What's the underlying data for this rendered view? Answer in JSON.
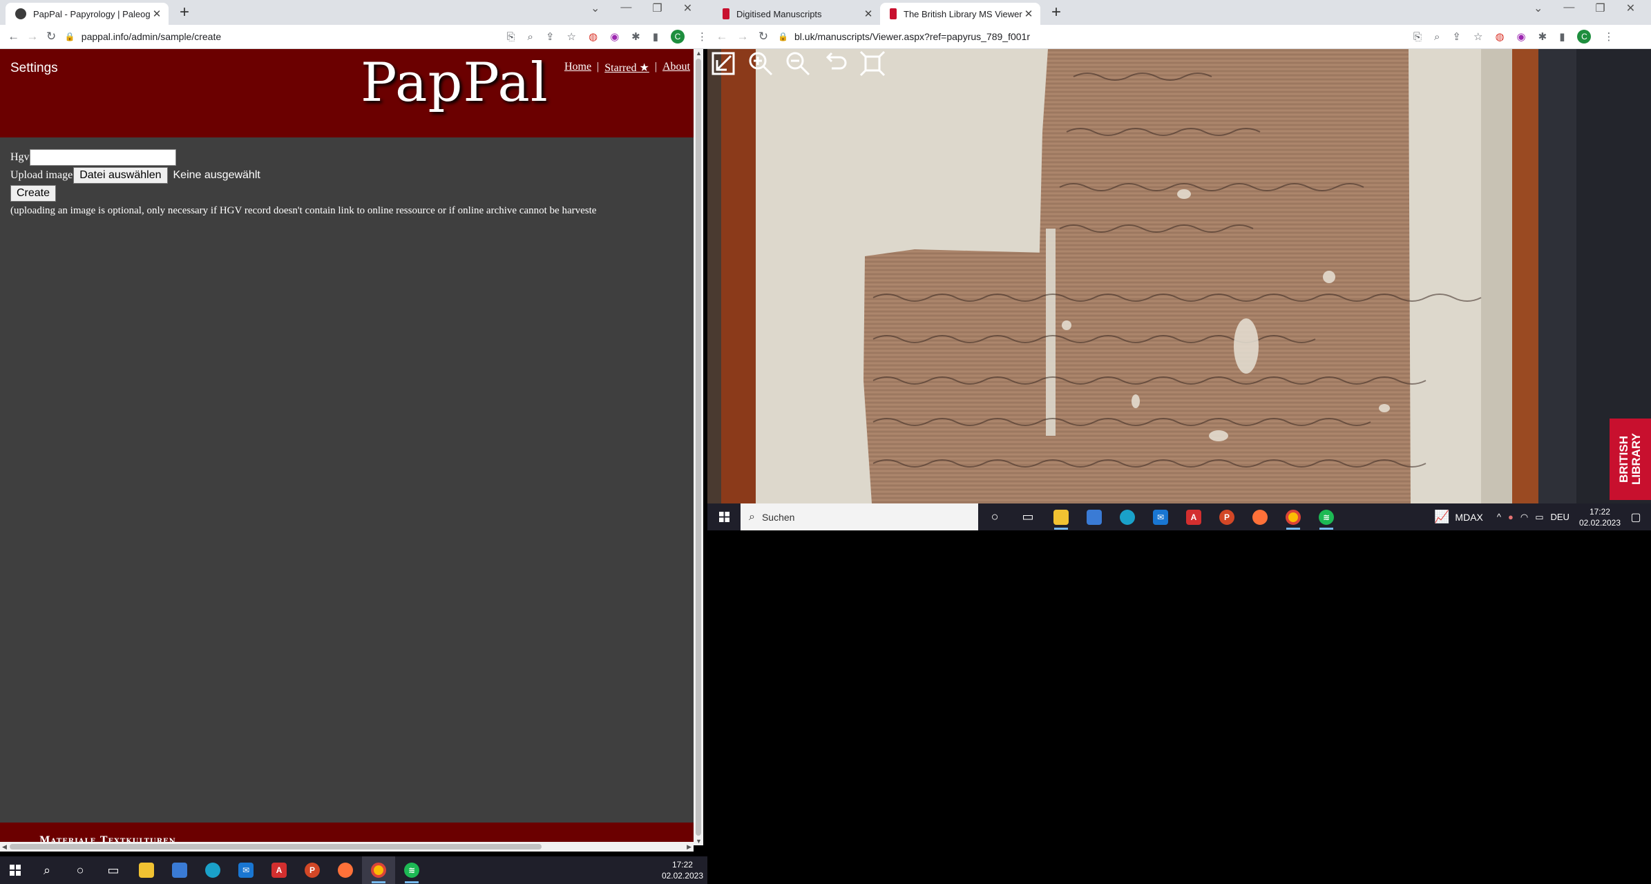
{
  "left_browser": {
    "tabs": [
      {
        "title": "PapPal - Papyrology | Paleography",
        "active": true
      }
    ],
    "address": "pappal.info/admin/sample/create",
    "profile_initial": "C"
  },
  "pappal": {
    "settings_label": "Settings",
    "logo": "PapPal",
    "nav": {
      "home": "Home",
      "sep1": "|",
      "starred": "Starred ★",
      "sep2": "|",
      "about": "About"
    },
    "form": {
      "hgv_label": "Hgv",
      "hgv_value": "",
      "upload_label": "Upload image",
      "file_button": "Datei auswählen",
      "file_status": "Keine ausgewählt",
      "create_button": "Create",
      "note": "(uploading an image is optional, only necessary if HGV record doesn't contain link to online ressource or if online archive cannot be harveste"
    },
    "footer_text": "Materiale Textkulturen"
  },
  "right_browser": {
    "tabs": [
      {
        "title": "Digitised Manuscripts",
        "active": false
      },
      {
        "title": "The British Library MS Viewer",
        "active": true
      }
    ],
    "address": "bl.uk/manuscripts/Viewer.aspx?ref=papyrus_789_f001r",
    "profile_initial": "C"
  },
  "bl_viewer": {
    "tools": [
      "exit-viewer-icon",
      "zoom-in-icon",
      "zoom-out-icon",
      "rotate-icon",
      "fullscreen-icon"
    ],
    "badge": "BRITISH LIBRARY"
  },
  "taskbar_main": {
    "time": "17:22",
    "date": "02.02.2023"
  },
  "taskbar_secondary": {
    "search_placeholder": "Suchen",
    "ticker": "MDAX",
    "language": "DEU",
    "time": "17:22",
    "date": "02.02.2023"
  },
  "colors": {
    "pappal_header": "#6b0000",
    "pappal_body": "#3f3f3f",
    "taskbar": "#1f1f2a",
    "chrome_tabstrip": "#dee1e6"
  }
}
